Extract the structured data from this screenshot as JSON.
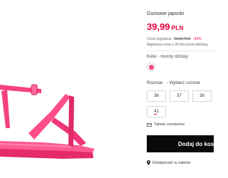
{
  "product": {
    "title": "Gumowe japonki",
    "price_value": "39,99",
    "price_currency": "PLN",
    "regular_label": "Cena regularna",
    "regular_price": "69,99 PLN",
    "discount": "-43%",
    "lowest_price_note": "Najniższa cena z 30 dni przed obniżką:"
  },
  "color": {
    "label": "Kolor",
    "value": "mocny różowy",
    "swatch_color": "#f24a8c"
  },
  "sizes": {
    "label": "Rozmiar",
    "prompt": "Wybierz rozmiar",
    "options": [
      "36",
      "37",
      "38",
      "41"
    ]
  },
  "size_table_label": "Tabela rozmiarów",
  "add_to_cart_label": "Dodaj do kos",
  "store_availability_label": "Dostępność w salonie",
  "icons": {
    "size_table": "ruler-icon",
    "store": "location-pin-icon"
  },
  "colors": {
    "accent": "#e5003f",
    "button": "#0a0a0a",
    "product": "#f5417f"
  }
}
